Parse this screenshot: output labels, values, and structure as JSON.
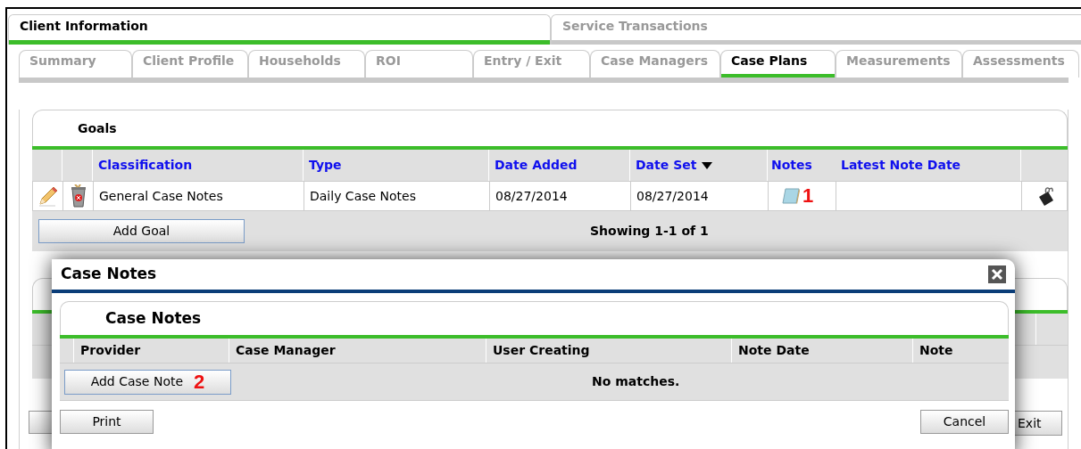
{
  "top_tabs": [
    {
      "label": "Client Information",
      "selected": true
    },
    {
      "label": "Service Transactions",
      "selected": false
    }
  ],
  "sub_tabs": [
    {
      "label": "Summary",
      "selected": false
    },
    {
      "label": "Client Profile",
      "selected": false
    },
    {
      "label": "Households",
      "selected": false
    },
    {
      "label": "ROI",
      "selected": false
    },
    {
      "label": "Entry / Exit",
      "selected": false
    },
    {
      "label": "Case Managers",
      "selected": false
    },
    {
      "label": "Case Plans",
      "selected": true
    },
    {
      "label": "Measurements",
      "selected": false
    },
    {
      "label": "Assessments",
      "selected": false
    }
  ],
  "goals": {
    "title": "Goals",
    "columns": [
      {
        "label": "Classification",
        "sorted": false
      },
      {
        "label": "Type",
        "sorted": false
      },
      {
        "label": "Date Added",
        "sorted": false
      },
      {
        "label": "Date Set",
        "sorted": true
      },
      {
        "label": "Notes",
        "sorted": false
      },
      {
        "label": "Latest Note Date",
        "sorted": false
      }
    ],
    "rows": [
      {
        "classification": "General Case Notes",
        "type": "Daily Case Notes",
        "date_added": "08/27/2014",
        "date_set": "08/27/2014",
        "notes_marker": "1"
      }
    ],
    "add_button": "Add Goal",
    "showing": "Showing 1-1 of 1"
  },
  "exit_button": "Exit",
  "dialog": {
    "title": "Case Notes",
    "panel_title": "Case Notes",
    "columns": [
      "Provider",
      "Case Manager",
      "User Creating",
      "Note Date",
      "Note"
    ],
    "add_button": "Add Case Note",
    "add_marker": "2",
    "empty_text": "No matches.",
    "buttons": [
      "Print",
      "Cancel"
    ]
  }
}
